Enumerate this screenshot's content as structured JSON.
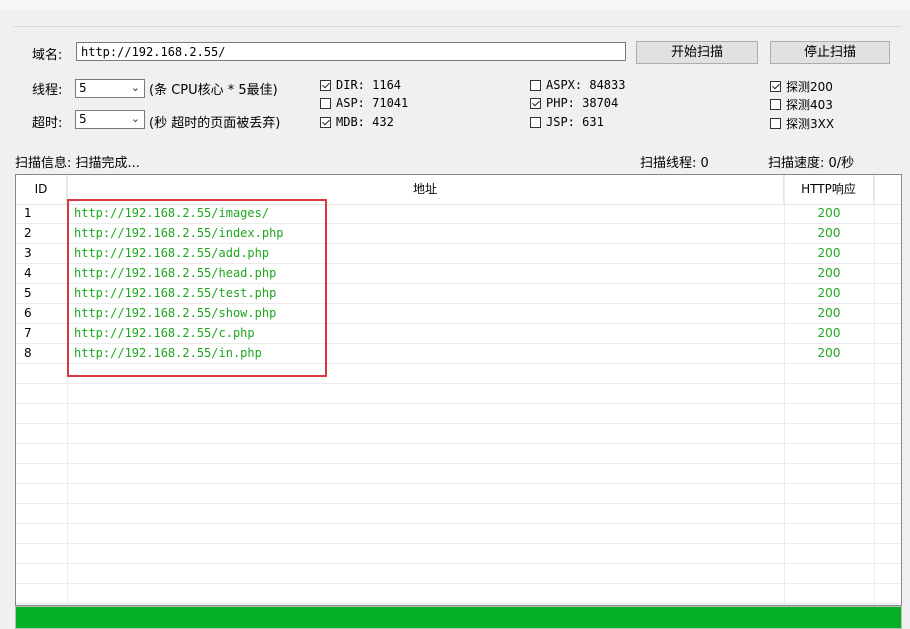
{
  "domain": {
    "label": "域名:",
    "value": "http://192.168.2.55/"
  },
  "buttons": {
    "start": "开始扫描",
    "stop": "停止扫描"
  },
  "threads": {
    "label": "线程:",
    "value": "5",
    "hint": "(条 CPU核心 * 5最佳)"
  },
  "timeout": {
    "label": "超时:",
    "value": "5",
    "hint": "(秒 超时的页面被丢弃)"
  },
  "dicts": [
    {
      "label": "DIR: 1164",
      "checked": true
    },
    {
      "label": "ASP: 71041",
      "checked": false
    },
    {
      "label": "MDB: 432",
      "checked": true
    },
    {
      "label": "ASPX: 84833",
      "checked": false
    },
    {
      "label": "PHP: 38704",
      "checked": true
    },
    {
      "label": "JSP: 631",
      "checked": false
    }
  ],
  "probes": [
    {
      "label": "探测200",
      "checked": true
    },
    {
      "label": "探测403",
      "checked": false
    },
    {
      "label": "探测3XX",
      "checked": false
    }
  ],
  "status": {
    "info": "扫描信息: 扫描完成...",
    "threads": "扫描线程: 0",
    "speed": "扫描速度: 0/秒"
  },
  "table": {
    "headers": {
      "id": "ID",
      "url": "地址",
      "code": "HTTP响应"
    },
    "rows": [
      {
        "id": "1",
        "url": "http://192.168.2.55/images/",
        "code": "200"
      },
      {
        "id": "2",
        "url": "http://192.168.2.55/index.php",
        "code": "200"
      },
      {
        "id": "3",
        "url": "http://192.168.2.55/add.php",
        "code": "200"
      },
      {
        "id": "4",
        "url": "http://192.168.2.55/head.php",
        "code": "200"
      },
      {
        "id": "5",
        "url": "http://192.168.2.55/test.php",
        "code": "200"
      },
      {
        "id": "6",
        "url": "http://192.168.2.55/show.php",
        "code": "200"
      },
      {
        "id": "7",
        "url": "http://192.168.2.55/c.php",
        "code": "200"
      },
      {
        "id": "8",
        "url": "http://192.168.2.55/in.php",
        "code": "200"
      }
    ]
  },
  "progress": {
    "fraction": 1.0
  },
  "colors": {
    "url_text": "#1ea61e",
    "progress_fill": "#06b025",
    "highlight_box": "#d9363e"
  },
  "icons": {
    "combo_arrow": "chevron-down-icon",
    "checkbox_check": "check-icon"
  }
}
